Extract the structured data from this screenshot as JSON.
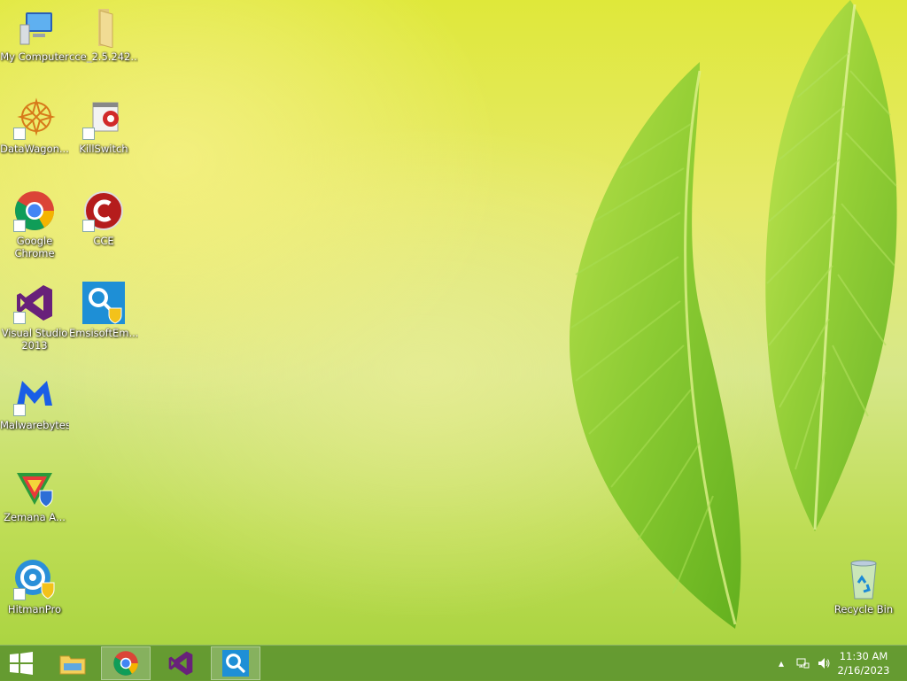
{
  "desktop": {
    "icons": [
      {
        "label": "My Computer"
      },
      {
        "label": "cce_2.5.242..."
      },
      {
        "label": "DataWagon..."
      },
      {
        "label": "KillSwitch"
      },
      {
        "label": "Google Chrome"
      },
      {
        "label": "CCE"
      },
      {
        "label": "Visual Studio 2013"
      },
      {
        "label": "EmsisoftEm..."
      },
      {
        "label": "Malwarebytes"
      },
      {
        "label": "Zemana A..."
      },
      {
        "label": "HitmanPro"
      },
      {
        "label": "Recycle Bin"
      }
    ]
  },
  "taskbar": {
    "clock": {
      "time": "11:30 AM",
      "date": "2/16/2023"
    }
  },
  "colors": {
    "taskbar": "#609630",
    "wallpaper_leaf": "#7cc428"
  }
}
